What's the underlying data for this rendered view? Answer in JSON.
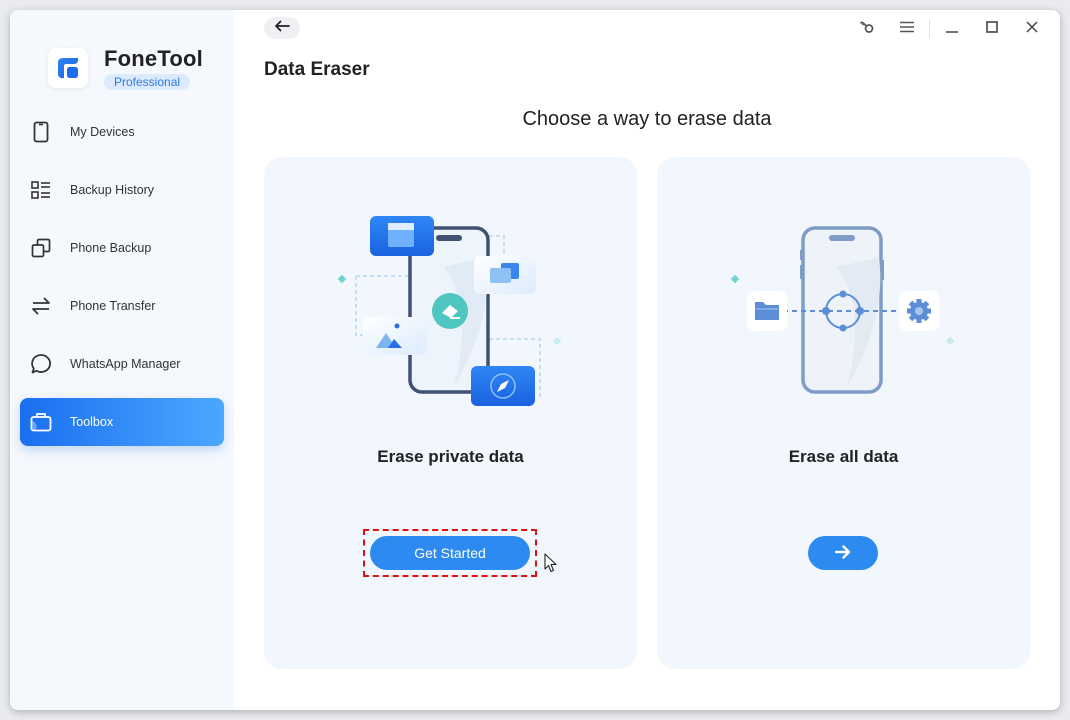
{
  "app": {
    "name": "FoneTool",
    "edition": "Professional"
  },
  "sidebar": {
    "items": [
      {
        "label": "My Devices",
        "icon": "phone-icon",
        "active": false
      },
      {
        "label": "Backup History",
        "icon": "list-icon",
        "active": false
      },
      {
        "label": "Phone Backup",
        "icon": "copy-icon",
        "active": false
      },
      {
        "label": "Phone Transfer",
        "icon": "transfer-arrows-icon",
        "active": false
      },
      {
        "label": "WhatsApp Manager",
        "icon": "chat-bubble-icon",
        "active": false
      },
      {
        "label": "Toolbox",
        "icon": "toolbox-icon",
        "active": true
      }
    ]
  },
  "header": {
    "back_icon": "arrow-left-icon",
    "title": "Data Eraser",
    "window_controls": [
      "key-icon",
      "menu-icon",
      "minimize-icon",
      "maximize-icon",
      "close-icon"
    ]
  },
  "main": {
    "subtitle": "Choose a way to erase data",
    "options": [
      {
        "title": "Erase private data",
        "button_label": "Get Started",
        "highlighted": true
      },
      {
        "title": "Erase all data",
        "button_icon": "arrow-right-icon",
        "highlighted": false
      }
    ]
  },
  "colors": {
    "accent": "#2d8af0",
    "highlight_border": "#e01010",
    "sidebar_bg": "#f5f8fd",
    "card_bg": "#f2f6fd"
  }
}
